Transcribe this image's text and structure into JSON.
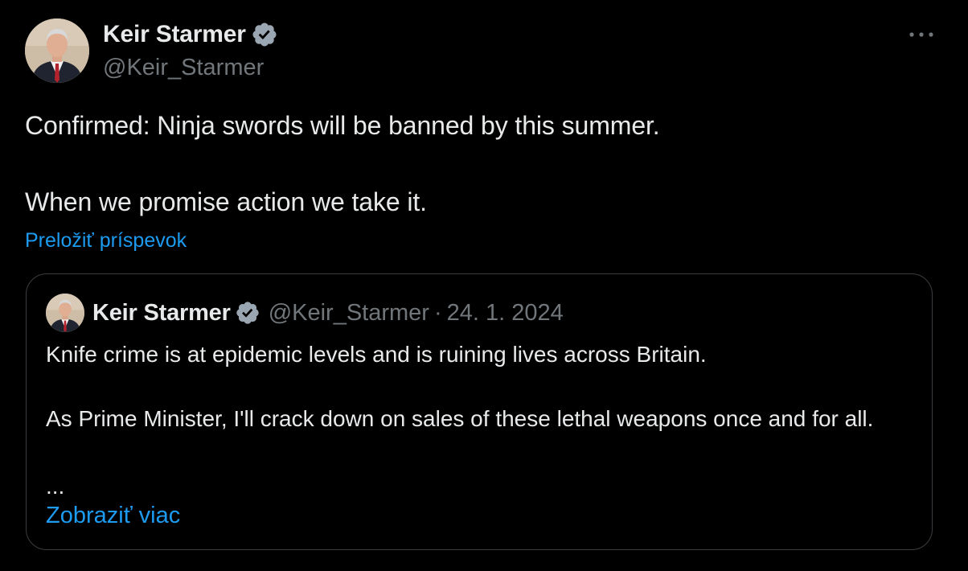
{
  "tweet": {
    "author_name": "Keir Starmer",
    "author_handle": "@Keir_Starmer",
    "text_line1": "Confirmed: Ninja swords will be banned by this summer.",
    "text_line2": "When we promise action we take it.",
    "translate_label": "Preložiť príspevok",
    "avatar_icon": "profile-photo",
    "verified_icon": "verified-badge-icon",
    "more_icon": "more-horizontal-icon"
  },
  "quoted_tweet": {
    "author_name": "Keir Starmer",
    "author_handle": "@Keir_Starmer",
    "separator": "·",
    "date": "24. 1. 2024",
    "text_line1": "Knife crime is at epidemic levels and is ruining lives across Britain.",
    "text_line2": "As Prime Minister, I'll crack down on sales of these lethal weapons once and for all.",
    "ellipsis": "...",
    "show_more_label": "Zobraziť viac"
  },
  "colors": {
    "background": "#000000",
    "text_primary": "#e7e9ea",
    "text_secondary": "#71767b",
    "link": "#1d9bf0",
    "verified_badge": "#9aa6b1",
    "border": "#3a3d41"
  }
}
